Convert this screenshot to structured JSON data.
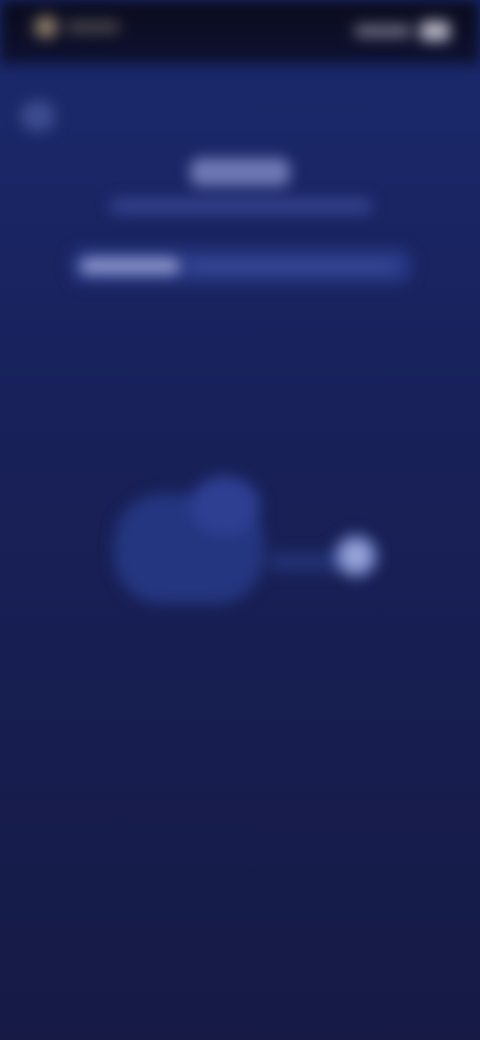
{
  "theme": {
    "background": "#161a45",
    "accent": "#6e79b5",
    "status_bar": "#0e1130"
  },
  "icons": {
    "back": "chevron-left-icon",
    "signal": "signal-icon",
    "battery": "battery-icon"
  },
  "header": {
    "title": "",
    "subtitle": ""
  },
  "card": {
    "label": ""
  }
}
